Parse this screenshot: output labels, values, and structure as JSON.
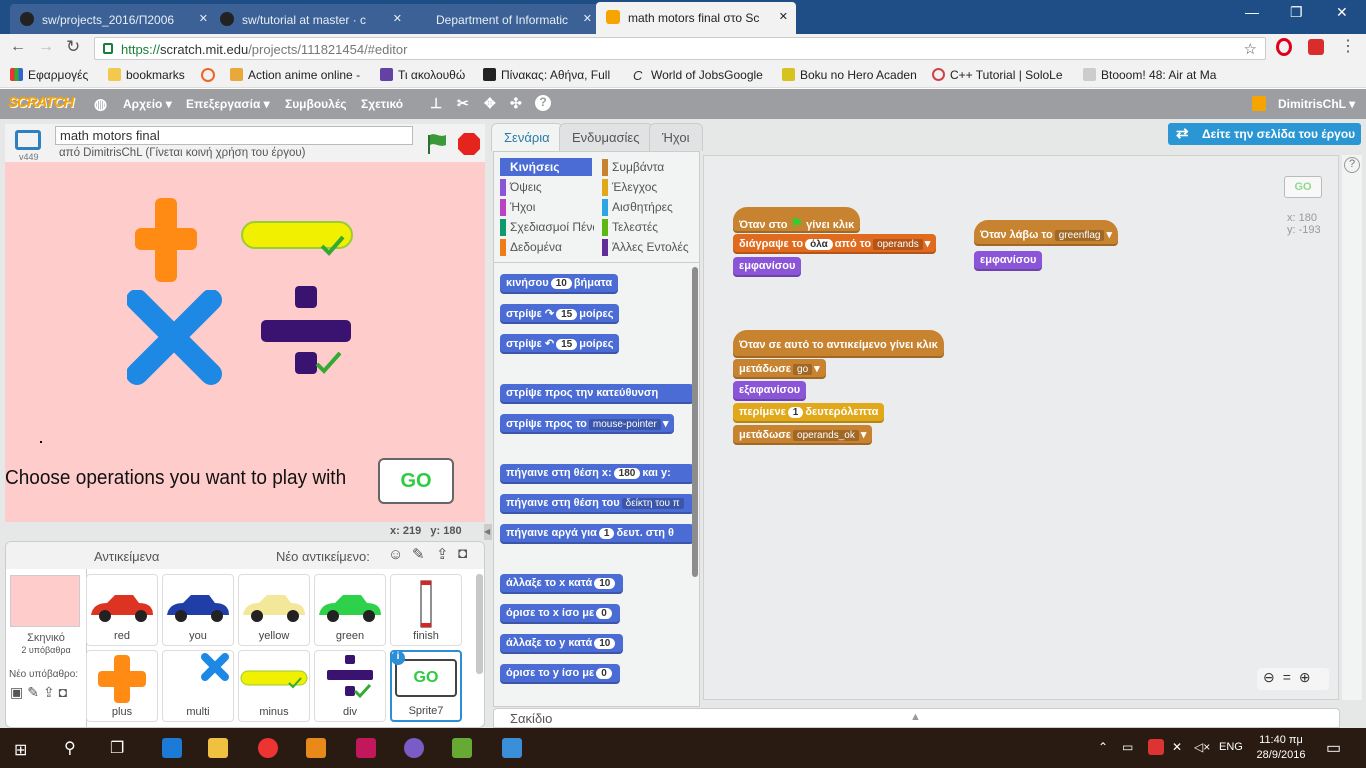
{
  "browser": {
    "tabs": [
      {
        "title": "sw/projects_2016/Π2006",
        "active": false
      },
      {
        "title": "sw/tutorial at master · c",
        "active": false
      },
      {
        "title": "Department of Informatic",
        "active": false
      },
      {
        "title": "math motors final στο Sc",
        "active": true
      }
    ],
    "url_secure": "https://",
    "url_host": "scratch.mit.edu",
    "url_path": "/projects/111821454/#editor",
    "bookmarks": [
      "Εφαρμογές",
      "bookmarks",
      "Action anime online -",
      "Τι ακολουθώ",
      "Πίνακας: Αθήνα, Full",
      "World of JobsGoogle",
      "Boku no Hero Acaden",
      "C++ Tutorial | SoloLe",
      "Btooom! 48: Air at Ma"
    ]
  },
  "scratch_menu": {
    "logo": "SCRATCH",
    "items": [
      "Αρχείο ▾",
      "Επεξεργασία ▾",
      "Συμβουλές",
      "Σχετικό"
    ],
    "user": "DimitrisChL ▾"
  },
  "stage": {
    "version": "v449",
    "project_title": "math motors final",
    "byline": "από DimitrisChL (Γίνεται κοινή χρήση του έργου)",
    "instruction": "Choose operations you want to play with",
    "go_label": "GO",
    "coord_x": "x: 219",
    "coord_y": "y: 180"
  },
  "sprites_panel": {
    "title": "Αντικείμενα",
    "new_sprite": "Νέο αντικείμενο:",
    "backdrop_label": "Σκηνικό",
    "backdrop_count": "2 υπόβαθρα",
    "new_backdrop": "Νέο υπόβαθρο:",
    "sprites": [
      "red",
      "you",
      "yellow",
      "green",
      "finish",
      "plus",
      "multi",
      "minus",
      "div",
      "Sprite7"
    ]
  },
  "editor_tabs": [
    "Σενάρια",
    "Ενδυμασίες",
    "Ήχοι"
  ],
  "see_project_page": "Δείτε την σελίδα του έργου",
  "categories_left": [
    "Κινήσεις",
    "Όψεις",
    "Ήχοι",
    "Σχεδιασμοί Πένα",
    "Δεδομένα"
  ],
  "categories_right": [
    "Συμβάντα",
    "Έλεγχος",
    "Αισθητήρες",
    "Τελεστές",
    "Άλλες Εντολές"
  ],
  "category_colors": [
    "#4a6cd4",
    "#8a55d7",
    "#bb42c3",
    "#0e9a6c",
    "#ee7d16",
    "#c88330",
    "#e1a91a",
    "#2ca5e2",
    "#5cb712",
    "#632d99"
  ],
  "palette_blocks": {
    "move": "κινήσου",
    "move_val": "10",
    "move_unit": "βήματα",
    "turn_r": "στρίψε",
    "turn_r_val": "15",
    "turn_r_unit": "μοίρες",
    "turn_l": "στρίψε",
    "turn_l_val": "15",
    "turn_l_unit": "μοίρες",
    "point_dir": "στρίψε προς την κατεύθυνση",
    "point_to": "στρίψε προς το",
    "point_to_val": "mouse-pointer",
    "goto_xy": "πήγαινε στη θέση x:",
    "goto_x": "180",
    "goto_y": "και y:",
    "goto_to": "πήγαινε στη θέση του",
    "goto_to_val": "δείκτη του π",
    "glide": "πήγαινε αργά για",
    "glide_val": "1",
    "glide_unit": "δευτ. στη θ",
    "change_x": "άλλαξε το x κατά",
    "change_x_val": "10",
    "set_x": "όρισε το x ίσο με",
    "set_x_val": "0",
    "change_y": "άλλαξε το y κατά",
    "change_y_val": "10",
    "set_y": "όρισε το y ίσο με",
    "set_y_val": "0"
  },
  "scripts": {
    "s1_hat": "Όταν στο",
    "s1_hat2": "γίνει κλικ",
    "s1_del": "διάγραψε το",
    "s1_del_val": "όλα",
    "s1_del_mid": "από το",
    "s1_del_list": "operands",
    "s1_show": "εμφανίσου",
    "s2_hat": "Όταν λάβω το",
    "s2_msg": "greenflag",
    "s2_show": "εμφανίσου",
    "s3_hat": "Όταν σε αυτό το αντικείμενο γίνει κλικ",
    "s3_broadcast": "μετάδωσε",
    "s3_broadcast_val": "go",
    "s3_hide": "εξαφανίσου",
    "s3_wait": "περίμενε",
    "s3_wait_val": "1",
    "s3_wait_unit": "δευτερόλεπτα",
    "s3_broadcast2": "μετάδωσε",
    "s3_broadcast2_val": "operands_ok"
  },
  "script_area": {
    "go_thumb": "GO",
    "x": "x: 180",
    "y": "y: -193"
  },
  "backpack": "Σακίδιο",
  "taskbar": {
    "lang": "ENG",
    "time": "11:40 πμ",
    "date": "28/9/2016"
  }
}
